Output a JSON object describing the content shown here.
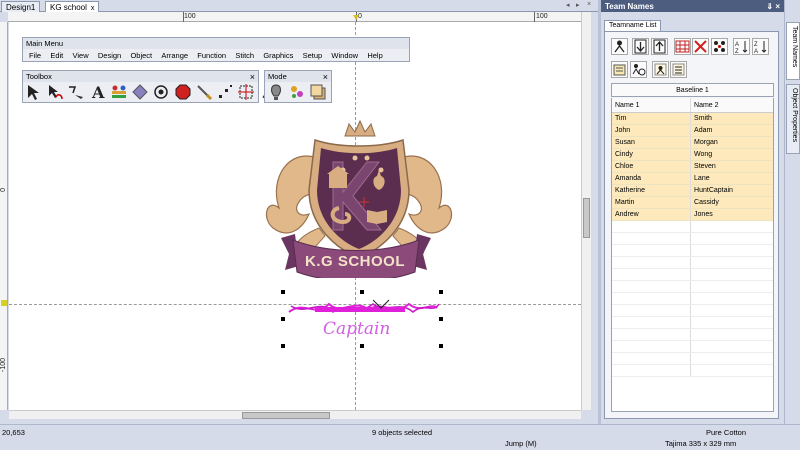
{
  "doc_tabs": {
    "design1": "Design1",
    "kg_school": "KG school",
    "close_glyph": "x",
    "nav_left": "◂",
    "nav_right": "▸",
    "nav_close": "×"
  },
  "ruler": {
    "top_labels": [
      "100",
      "0",
      "100"
    ],
    "left_labels": [
      "0",
      "-100"
    ]
  },
  "main_menu": {
    "title": "Main Menu",
    "items": [
      "File",
      "Edit",
      "View",
      "Design",
      "Object",
      "Arrange",
      "Function",
      "Stitch",
      "Graphics",
      "Setup",
      "Window",
      "Help"
    ]
  },
  "toolbox": {
    "title": "Toolbox",
    "close": "×",
    "tools": [
      "select-icon",
      "reshape-icon",
      "path-icon",
      "lettering-icon",
      "team-names-icon",
      "fill-icon",
      "circle-icon",
      "stop-icon",
      "knife-icon",
      "points-icon",
      "bounding-icon",
      "paint-icon"
    ]
  },
  "mode_toolbar": {
    "title": "Mode",
    "close": "×",
    "tools": [
      "mode-hot-air-icon",
      "mode-sparkle-icon",
      "mode-stack-icon"
    ]
  },
  "design": {
    "banner_text": "K.G SCHOOL",
    "names_text": "Captain",
    "colors": {
      "crest_dark": "#5b2d4f",
      "crest_gold": "#d8ad82",
      "banner": "#8b4a7a",
      "lettering": "#e020d8"
    }
  },
  "status": {
    "coords": "20,653",
    "selection": "9 objects selected",
    "jump": "Jump (M)",
    "fabric": "Pure Cotton",
    "machine": "Tajima 335 x 329 mm"
  },
  "panel": {
    "title": "Team Names",
    "pin": "⇓",
    "close": "×",
    "tab": "Teamname List",
    "baseline": "Baseline 1",
    "columns": [
      "Name 1",
      "Name 2"
    ],
    "rows": [
      [
        "Tim",
        "Smith"
      ],
      [
        "John",
        "Adam"
      ],
      [
        "Susan",
        "Morgan"
      ],
      [
        "Cindy",
        "Wong"
      ],
      [
        "Chloe",
        "Steven"
      ],
      [
        "Amanda",
        "Lane"
      ],
      [
        "Katherine",
        "HuntCaptain"
      ],
      [
        "Martin",
        "Cassidy"
      ],
      [
        "Andrew",
        "Jones"
      ]
    ]
  },
  "side_tabs": [
    "Team Names",
    "Object Properties"
  ]
}
